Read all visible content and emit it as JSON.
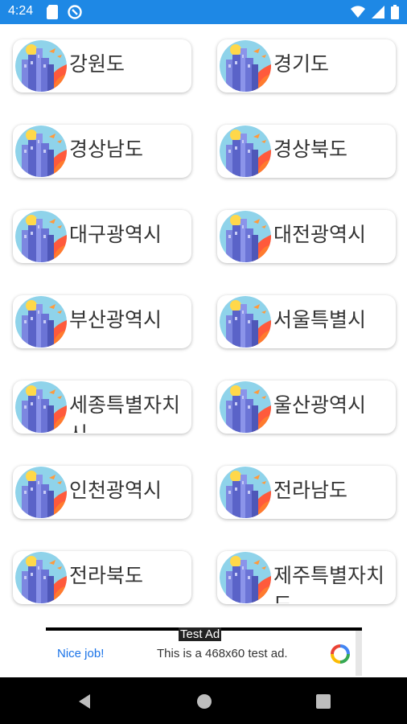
{
  "status_bar": {
    "time": "4:24",
    "background": "#1e88e5",
    "left_icons": [
      "sd-card-icon",
      "do-not-disturb-icon"
    ],
    "right_icons": [
      "wifi-icon",
      "signal-icon",
      "battery-icon"
    ]
  },
  "regions": [
    "강원도",
    "경기도",
    "경상남도",
    "경상북도",
    "대구광역시",
    "대전광역시",
    "부산광역시",
    "서울특별시",
    "세종특별자치시",
    "울산광역시",
    "인천광역시",
    "전라남도",
    "전라북도",
    "제주특별자치도"
  ],
  "ad": {
    "test_label": "Test Ad",
    "nice": "Nice job!",
    "description": "This is a 468x60 test ad."
  },
  "nav_bar": {
    "buttons": [
      "back-icon",
      "home-icon",
      "recents-icon"
    ]
  }
}
